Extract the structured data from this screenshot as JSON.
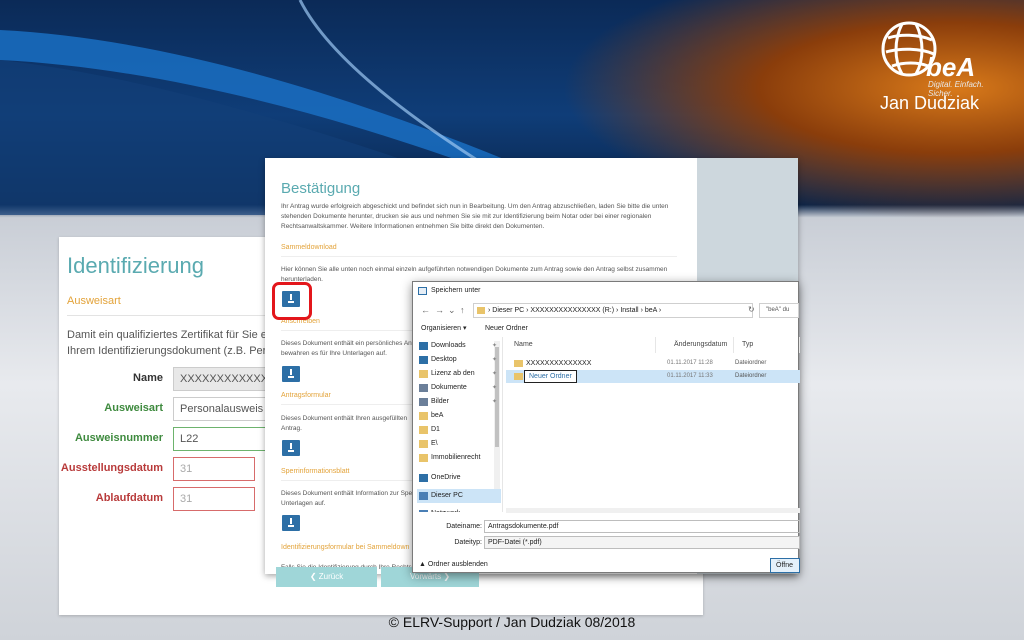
{
  "branding": {
    "logo_text": "beA",
    "tagline": "Digital. Einfach. Sicher.",
    "author": "Jan Dudziak"
  },
  "identifizierung": {
    "title": "Identifizierung",
    "section": "Ausweisart",
    "intro_line1": "Damit ein qualifiziertes Zertifikat für Sie erstel",
    "intro_line2": "Ihrem Identifizierungsdokument (z.B. Persona",
    "fields": [
      {
        "label": "Name",
        "value": "XXXXXXXXXXXXXXX"
      },
      {
        "label": "Ausweisart",
        "value": "Personalausweis e"
      },
      {
        "label": "Ausweisnummer",
        "value": "L22"
      },
      {
        "label": "Ausstellungsdatum",
        "value": "31"
      },
      {
        "label": "Ablaufdatum",
        "value": "31"
      }
    ]
  },
  "bestaetigung": {
    "title": "Bestätigung",
    "intro1": "Ihr Antrag wurde erfolgreich abgeschickt und befindet sich nun in Bearbeitung. Um den Antrag abzuschließen, laden Sie bitte die unten",
    "intro2": "stehenden Dokumente herunter, drucken sie aus und nehmen Sie sie mit zur Identifizierung beim Notar oder bei einer regionalen",
    "intro3": "Rechtsanwaltskammer. Weitere Informationen entnehmen Sie bitte direkt den Dokumenten.",
    "sammel_title": "Sammeldownload",
    "sammel_text": "Hier können Sie alle unten noch einmal einzeln aufgeführten notwendigen Dokumente zum Antrag sowie den Antrag selbst zusammen",
    "sammel_text2": "herunterladen.",
    "anschreiben_title": "Anschreiben",
    "anschreiben_text1": "Dieses Dokument enthält ein persönliches Antr",
    "anschreiben_text2": "bewahren es für Ihre Unterlagen auf.",
    "antrag_title": "Antragsformular",
    "antrag_text1": "Dieses Dokument enthält Ihren ausgefüllten",
    "antrag_text2": "Antrag.",
    "sperr_title": "Sperrinformationsblatt",
    "sperr_text1": "Dieses Dokument enthält Information zur Spe",
    "sperr_text2": "Unterlagen auf.",
    "ident_title": "Identifizierungsformular bei Sammeldown",
    "ident_text": "Falls Sie die Identifizierung durch Ihre Rechtsa",
    "back": "❮ Zurück",
    "forward": "Vorwärts ❯"
  },
  "dialog": {
    "title": "Speichern unter",
    "path_segments": [
      "Dieser PC",
      "XXXXXXXXXXXXXXX",
      "(R:)",
      "Install",
      "beA"
    ],
    "search_placeholder": "\"beA\" du",
    "organize": "Organisieren ▾",
    "new_folder": "Neuer Ordner",
    "tree": [
      {
        "label": "Downloads",
        "pinned": true
      },
      {
        "label": "Desktop",
        "pinned": true
      },
      {
        "label": "Lizenz ab den",
        "pinned": true
      },
      {
        "label": "Dokumente",
        "pinned": true
      },
      {
        "label": "Bilder",
        "pinned": true
      },
      {
        "label": "beA",
        "pinned": false
      },
      {
        "label": "D1",
        "pinned": false
      },
      {
        "label": "E\\",
        "pinned": false
      },
      {
        "label": "Immobilienrecht",
        "pinned": false
      },
      {
        "label": "OneDrive",
        "pinned": false
      },
      {
        "label": "Dieser PC",
        "pinned": false
      },
      {
        "label": "Netzwerk",
        "pinned": false
      }
    ],
    "columns": {
      "name": "Name",
      "date": "Änderungsdatum",
      "type": "Typ"
    },
    "files": [
      {
        "name": "XXXXXXXXXXXXXX",
        "date": "01.11.2017 11:28",
        "type": "Dateiordner"
      },
      {
        "name": "Neuer Ordner",
        "date": "01.11.2017 11:33",
        "type": "Dateiordner"
      }
    ],
    "filename_label": "Dateiname:",
    "filename_value": "Antragsdokumente.pdf",
    "filetype_label": "Dateityp:",
    "filetype_value": "PDF-Datei (*.pdf)",
    "hide_folders": "Ordner ausblenden",
    "open_button": "Öffne"
  },
  "footer": "© ELRV-Support / Jan Dudziak 08/2018"
}
